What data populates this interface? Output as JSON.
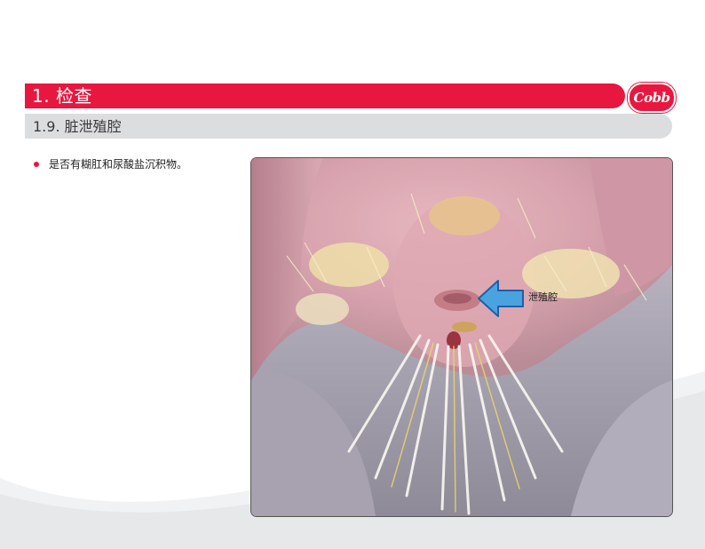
{
  "header": {
    "title": "1. 检查",
    "logo_text": "Cobb"
  },
  "section": {
    "subtitle": "1.9. 脏泄殖腔"
  },
  "content": {
    "bullets": [
      {
        "text": "是否有糊肛和尿酸盐沉积物。"
      }
    ]
  },
  "figure": {
    "annotation_label": "泄殖腔",
    "arrow_icon": "left-arrow-icon"
  },
  "colors": {
    "accent": "#e8173f",
    "subtitle_bar": "#dcdddf",
    "arrow_fill": "#4aa3df",
    "arrow_stroke": "#1f5fa8"
  }
}
